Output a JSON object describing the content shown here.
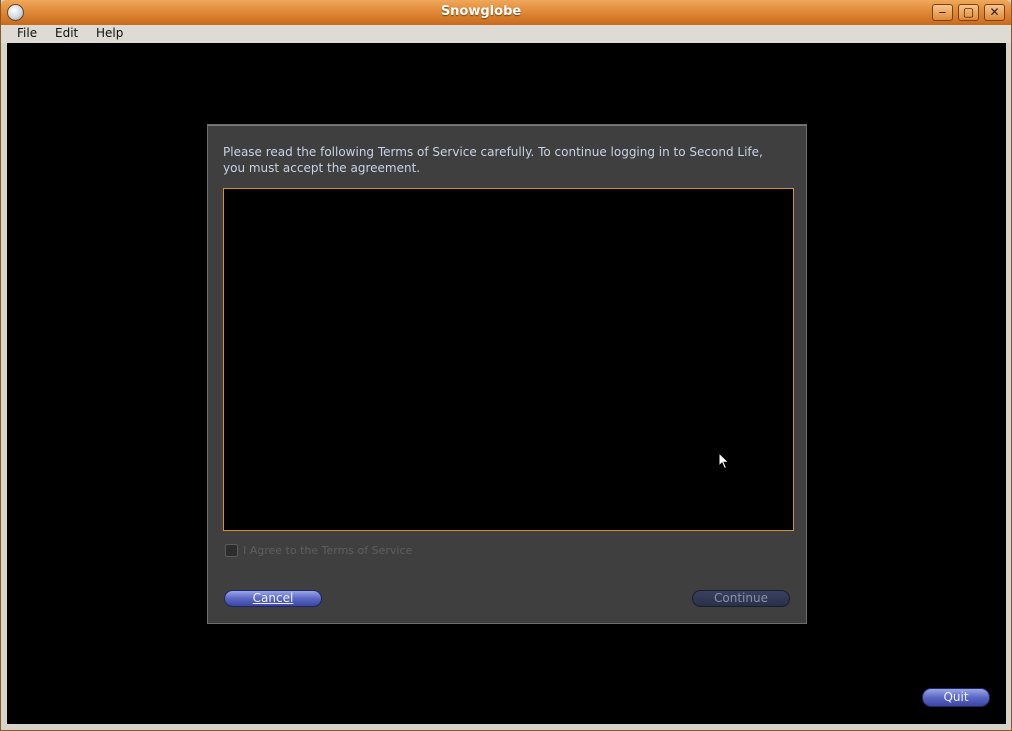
{
  "window": {
    "title": "Snowglobe",
    "controls": {
      "minimize": "‒",
      "maximize": "▢",
      "close": "✕"
    }
  },
  "menu": {
    "items": [
      {
        "label": "File"
      },
      {
        "label": "Edit"
      },
      {
        "label": "Help"
      }
    ]
  },
  "tos_dialog": {
    "intro_line1": "Please read the following Terms of Service carefully. To continue logging in to Second Life,",
    "intro_line2": "you must accept the agreement.",
    "agree_label": "I Agree to the Terms of Service",
    "agree_checked": false,
    "cancel_label": "Cancel",
    "continue_label": "Continue",
    "continue_enabled": false
  },
  "viewport": {
    "quit_label": "Quit"
  },
  "colors": {
    "titlebar_accent": "#e08a38",
    "tos_box_border": "#d3922e",
    "button_blue": "#5b68c4",
    "dialog_bg": "#3f3f3f"
  }
}
